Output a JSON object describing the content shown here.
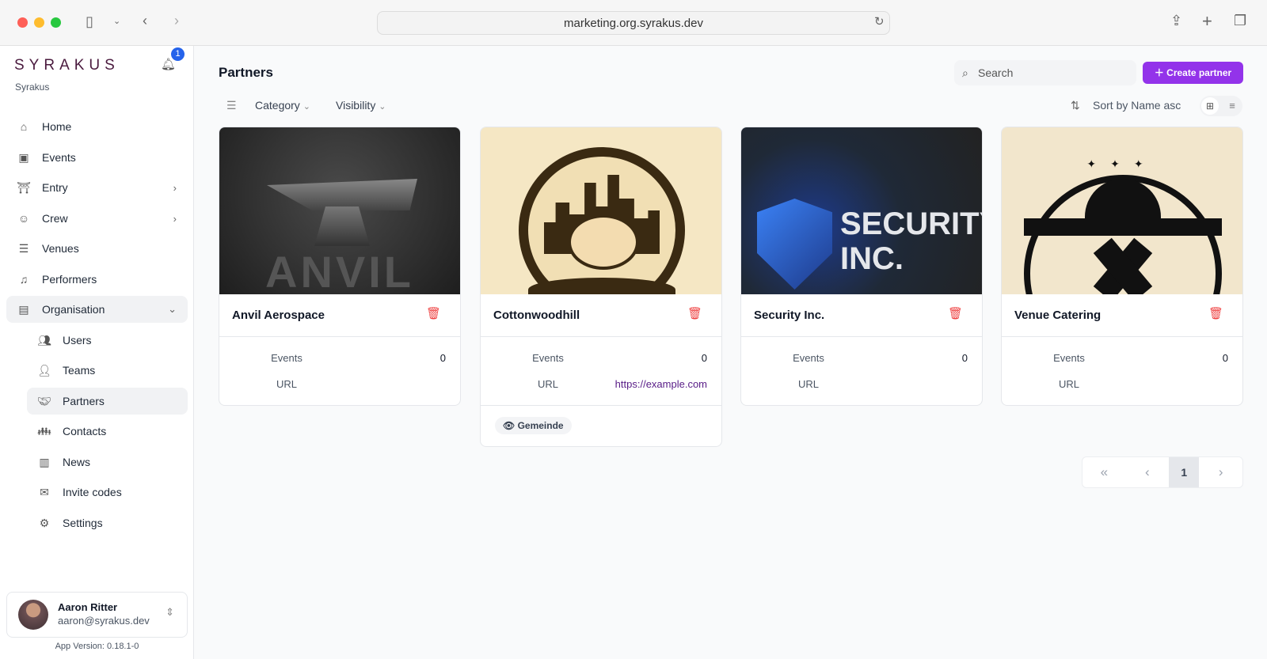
{
  "browser": {
    "url": "marketing.org.syrakus.dev"
  },
  "sidebar": {
    "logo": "SYRAKUS",
    "org": "Syrakus",
    "notifications": "1",
    "items": [
      {
        "label": "Home",
        "icon": "home-icon"
      },
      {
        "label": "Events",
        "icon": "calendar-icon"
      },
      {
        "label": "Entry",
        "icon": "entry-icon"
      },
      {
        "label": "Crew",
        "icon": "crew-icon"
      },
      {
        "label": "Venues",
        "icon": "venue-icon"
      },
      {
        "label": "Performers",
        "icon": "performer-icon"
      },
      {
        "label": "Organisation",
        "icon": "building-icon"
      }
    ],
    "sub_items": [
      {
        "label": "Users"
      },
      {
        "label": "Teams"
      },
      {
        "label": "Partners"
      },
      {
        "label": "Contacts"
      },
      {
        "label": "News"
      },
      {
        "label": "Invite codes"
      },
      {
        "label": "Settings"
      }
    ],
    "user": {
      "name": "Aaron Ritter",
      "email": "aaron@syrakus.dev"
    },
    "version": "App Version: 0.18.1-0"
  },
  "main": {
    "title": "Partners",
    "search_placeholder": "Search",
    "create_label": "Create partner",
    "filters": {
      "category": "Category",
      "visibility": "Visibility"
    },
    "sort": "Sort by Name asc",
    "cards": [
      {
        "name": "Anvil Aerospace",
        "events_label": "Events",
        "events": "0",
        "url_label": "URL",
        "url": "",
        "logo_text": "ANVIL"
      },
      {
        "name": "Cottonwoodhill",
        "events_label": "Events",
        "events": "0",
        "url_label": "URL",
        "url": "https://example.com",
        "tag": "Gemeinde"
      },
      {
        "name": "Security Inc.",
        "events_label": "Events",
        "events": "0",
        "url_label": "URL",
        "url": "",
        "logo_text": "SECURITY, INC."
      },
      {
        "name": "Venue Catering",
        "events_label": "Events",
        "events": "0",
        "url_label": "URL",
        "url": ""
      }
    ],
    "pagination": {
      "current": "1"
    }
  },
  "colors": {
    "accent": "#9333ea",
    "delete": "#ef4444",
    "link": "#581c87"
  }
}
